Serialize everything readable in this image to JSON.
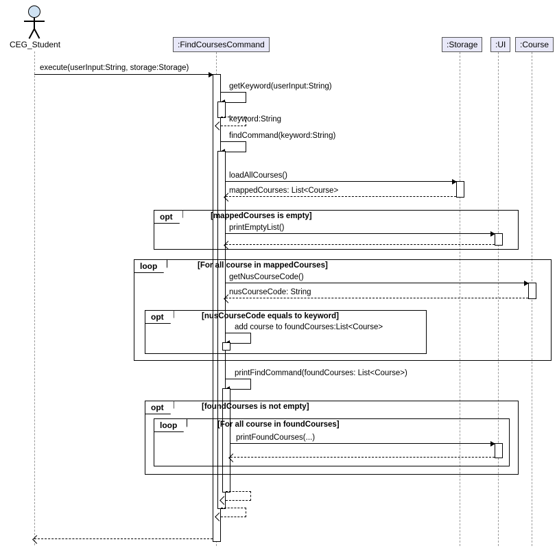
{
  "actor": {
    "name": "CEG_Student"
  },
  "participants": {
    "find": ":FindCoursesCommand",
    "storage": ":Storage",
    "ui": ":UI",
    "course": ":Course"
  },
  "messages": {
    "execute": "execute(userInput:String, storage:Storage)",
    "getKeyword": "getKeyword(userInput:String)",
    "keywordRet": "keyword:String",
    "findCommand": "findCommand(keyword:String)",
    "loadAll": "loadAllCourses()",
    "loadAllRet": "mappedCourses: List<Course>",
    "printEmpty": "printEmptyList()",
    "getNus": "getNusCourseCode()",
    "getNusRet": "nusCourseCode: String",
    "addCourse": "add course to foundCourses:List<Course>",
    "printFind": "printFindCommand(foundCourses: List<Course>)",
    "printFound": "printFoundCourses(...)"
  },
  "fragments": {
    "opt1": {
      "type": "opt",
      "guard": "[mappedCourses is empty]"
    },
    "loop1": {
      "type": "loop",
      "guard": "[For all course in mappedCourses]"
    },
    "opt2": {
      "type": "opt",
      "guard": "[nusCourseCode equals to keyword]"
    },
    "opt3": {
      "type": "opt",
      "guard": "[foundCourses is not empty]"
    },
    "loop2": {
      "type": "loop",
      "guard": "[For all course in foundCourses]"
    }
  }
}
